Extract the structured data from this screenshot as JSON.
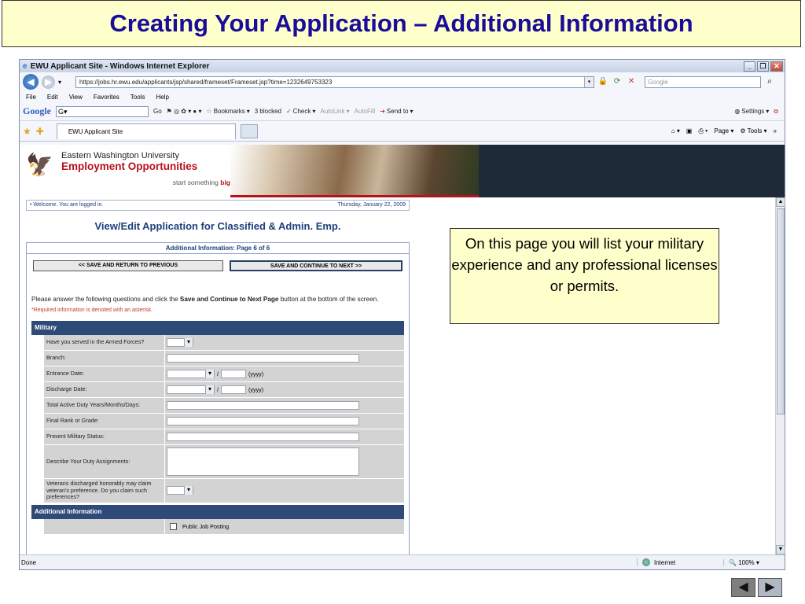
{
  "slide": {
    "title": "Creating Your Application – Additional Information",
    "callout": "On this page you will list your military experience and any professional licenses or permits."
  },
  "browser": {
    "window_title": "EWU Applicant Site - Windows Internet Explorer",
    "url": "https://jobs.hr.ewu.edu/applicants/jsp/shared/frameset/Frameset.jsp?time=1232649753323",
    "search_placeholder": "Google",
    "menu": [
      "File",
      "Edit",
      "View",
      "Favorites",
      "Tools",
      "Help"
    ],
    "google_toolbar": {
      "logo": "Google",
      "go": "Go",
      "bookmarks": "Bookmarks",
      "blocked": "3 blocked",
      "check": "Check",
      "autolink": "AutoLink",
      "autofill": "AutoFill",
      "sendto": "Send to",
      "settings": "Settings"
    },
    "tab_label": "EWU Applicant Site",
    "page_menu": "Page",
    "tools_menu": "Tools",
    "status": "Done",
    "zone": "Internet",
    "zoom": "100%"
  },
  "site": {
    "univ": "Eastern Washington University",
    "dept": "Employment Opportunities",
    "tagline_pre": "start something ",
    "tagline_bold": "big",
    "welcome": "Welcome. You are logged in.",
    "date": "Thursday, January 22, 2009",
    "page_heading": "View/Edit Application for Classified & Admin. Emp.",
    "form_header": "Additional Information: Page 6 of 6",
    "btn_prev": "<< SAVE AND RETURN TO PREVIOUS",
    "btn_next": "SAVE AND CONTINUE TO NEXT >>",
    "instructions_pre": "Please answer the following questions and click the ",
    "instructions_bold": "Save and Continue to Next Page",
    "instructions_post": " button at the bottom of the screen.",
    "required_note": "*Required information is denoted with an asterisk.",
    "section_military": "Military",
    "fields": {
      "armed_forces": "Have you served in the Armed Forces?",
      "branch": "Branch:",
      "entrance": "Entrance Date:",
      "discharge": "Discharge Date:",
      "active_duty": "Total Active Duty Years/Months/Days:",
      "rank": "Final Rank or Grade:",
      "status": "Present Military Status:",
      "duty": "Describe Your Duty Assignments:",
      "veterans": "Veterans discharged honorably may claim veteran's preference. Do you claim such preferences?"
    },
    "date_sep": "/",
    "yyyy": "(yyyy)",
    "section_additional": "Additional Information",
    "public_job_posting": "Public Job Posting"
  }
}
